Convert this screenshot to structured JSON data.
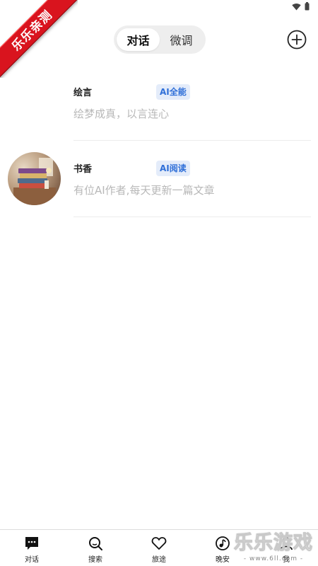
{
  "watermark": {
    "ribbon_text": "乐乐亲测",
    "brand": "乐乐游戏",
    "url": "- www.6ll.com -"
  },
  "header": {
    "tabs": [
      {
        "label": "对话",
        "active": true
      },
      {
        "label": "微调",
        "active": false
      }
    ],
    "add_icon": "plus-circle-icon"
  },
  "chats": [
    {
      "name": "绘言",
      "tag": "AI全能",
      "description": "绘梦成真，以言连心",
      "has_avatar": false
    },
    {
      "name": "书香",
      "tag": "AI阅读",
      "description": "有位AI作者,每天更新一篇文章",
      "has_avatar": true
    }
  ],
  "bottom_nav": [
    {
      "label": "对话",
      "icon": "chat-bubble-icon"
    },
    {
      "label": "搜索",
      "icon": "search-icon"
    },
    {
      "label": "旅途",
      "icon": "heart-icon"
    },
    {
      "label": "晚安",
      "icon": "music-note-icon"
    },
    {
      "label": "我",
      "icon": "profile-icon"
    }
  ],
  "colors": {
    "accent": "#2f6fd8",
    "tag_bg": "#e4ecfa",
    "muted_text": "#b8b8b8",
    "ribbon": "#d9141e"
  }
}
